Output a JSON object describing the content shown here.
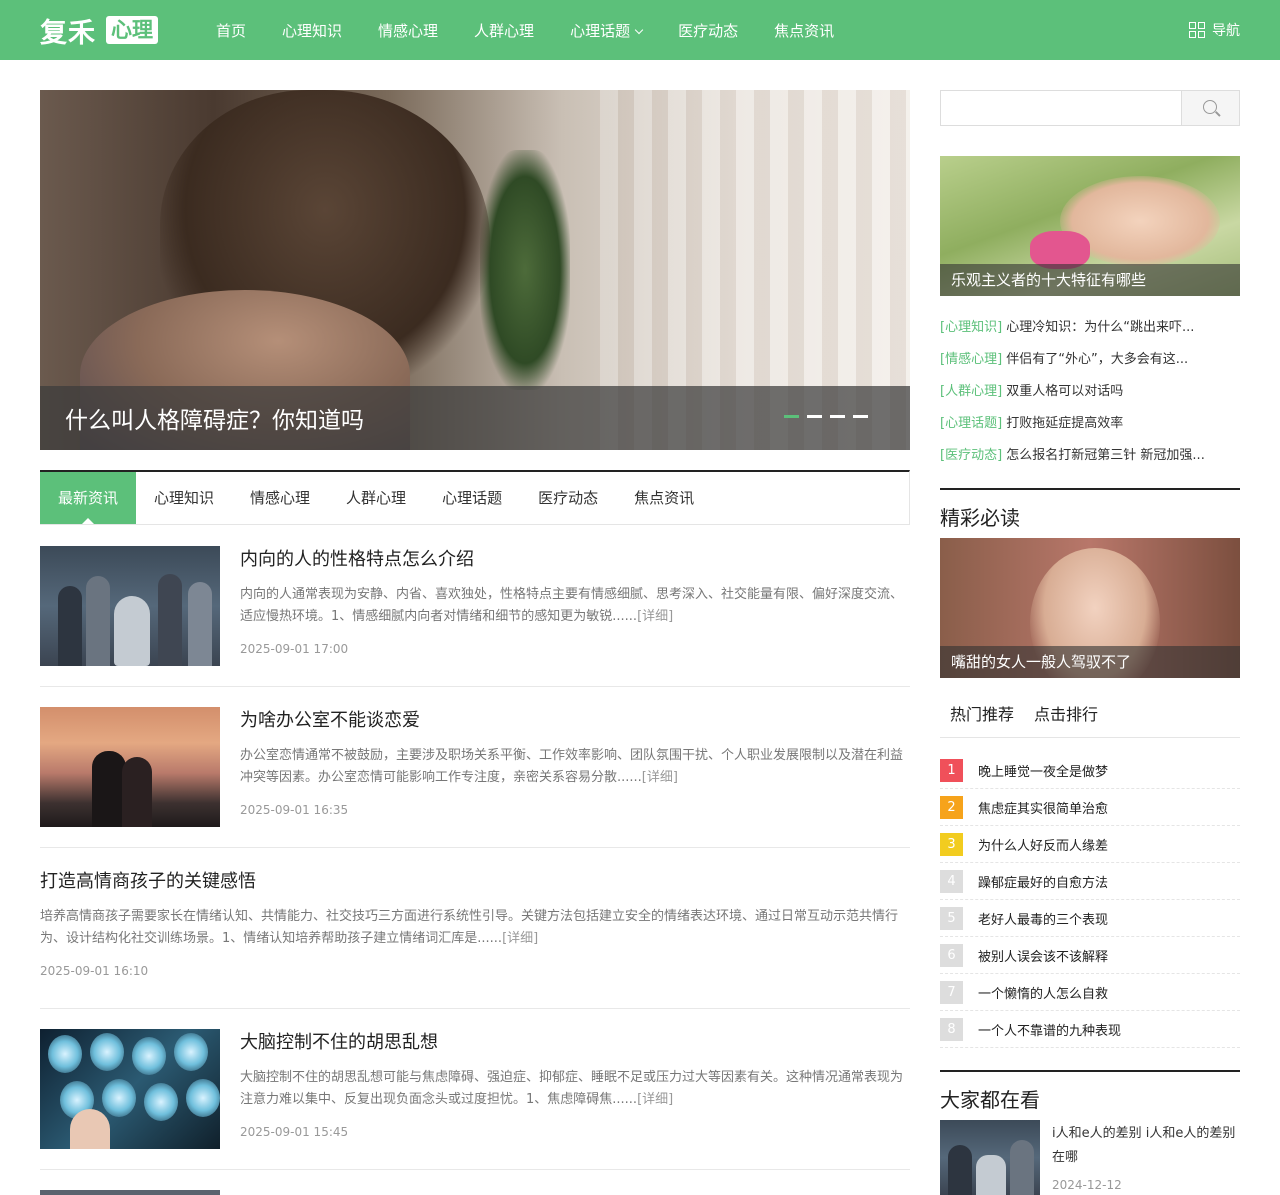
{
  "header": {
    "logo_main": "复禾",
    "logo_sub": "心理",
    "nav": [
      "首页",
      "心理知识",
      "情感心理",
      "人群心理",
      "心理话题",
      "医疗动态",
      "焦点资讯"
    ],
    "nav_right": "导航"
  },
  "hero": {
    "title": "什么叫人格障碍症？你知道吗"
  },
  "tabs": [
    "最新资讯",
    "心理知识",
    "情感心理",
    "人群心理",
    "心理话题",
    "医疗动态",
    "焦点资讯"
  ],
  "articles": [
    {
      "title": "内向的人的性格特点怎么介绍",
      "desc": "内向的人通常表现为安静、内省、喜欢独处，性格特点主要有情感细腻、思考深入、社交能量有限、偏好深度交流、适应慢热环境。1、情感细腻内向者对情绪和细节的感知更为敏锐......",
      "more": "[详细]",
      "date": "2025-09-01 17:00"
    },
    {
      "title": "为啥办公室不能谈恋爱",
      "desc": "办公室恋情通常不被鼓励，主要涉及职场关系平衡、工作效率影响、团队氛围干扰、个人职业发展限制以及潜在利益冲突等因素。办公室恋情可能影响工作专注度，亲密关系容易分散......",
      "more": "[详细]",
      "date": "2025-09-01 16:35"
    },
    {
      "title": "打造高情商孩子的关键感悟",
      "desc": "培养高情商孩子需要家长在情绪认知、共情能力、社交技巧三方面进行系统性引导。关键方法包括建立安全的情绪表达环境、通过日常互动示范共情行为、设计结构化社交训练场景。1、情绪认知培养帮助孩子建立情绪词汇库是......",
      "more": "[详细]",
      "date": "2025-09-01 16:10"
    },
    {
      "title": "大脑控制不住的胡思乱想",
      "desc": "大脑控制不住的胡思乱想可能与焦虑障碍、强迫症、抑郁症、睡眠不足或压力过大等因素有关。这种情况通常表现为注意力难以集中、反复出现负面念头或过度担忧。1、焦虑障碍焦......",
      "more": "[详细]",
      "date": "2025-09-01 15:45"
    }
  ],
  "sidebar": {
    "search_placeholder": "",
    "top_image_caption": "乐观主义者的十大特征有哪些",
    "cat_list": [
      {
        "cat": "[心理知识]",
        "text": "心理冷知识：为什么“跳出来吓..."
      },
      {
        "cat": "[情感心理]",
        "text": "伴侣有了“外心”，大多会有这..."
      },
      {
        "cat": "[人群心理]",
        "text": "双重人格可以对话吗"
      },
      {
        "cat": "[心理话题]",
        "text": "打败拖延症提高效率"
      },
      {
        "cat": "[医疗动态]",
        "text": "怎么报名打新冠第三针 新冠加强..."
      }
    ],
    "must_read_title": "精彩必读",
    "must_read_caption": "嘴甜的女人一般人驾驭不了",
    "rank_tabs": [
      "热门推荐",
      "点击排行"
    ],
    "rank_list": [
      {
        "num": "1",
        "text": "晚上睡觉一夜全是做梦",
        "color": "#f0505a"
      },
      {
        "num": "2",
        "text": "焦虑症其实很简单治愈",
        "color": "#f6a31b"
      },
      {
        "num": "3",
        "text": "为什么人好反而人缘差",
        "color": "#f2cc1f"
      },
      {
        "num": "4",
        "text": "躁郁症最好的自愈方法",
        "color": "#dddddd"
      },
      {
        "num": "5",
        "text": "老好人最毒的三个表现",
        "color": "#dddddd"
      },
      {
        "num": "6",
        "text": "被别人误会该不该解释",
        "color": "#dddddd"
      },
      {
        "num": "7",
        "text": "一个懒惰的人怎么自救",
        "color": "#dddddd"
      },
      {
        "num": "8",
        "text": "一个人不靠谱的九种表现",
        "color": "#dddddd"
      }
    ],
    "watch_title": "大家都在看",
    "watch_item": {
      "text": "i人和e人的差别 i人和e人的差别在哪",
      "date": "2024-12-12"
    }
  },
  "colors": {
    "brand": "#5cc07a"
  }
}
